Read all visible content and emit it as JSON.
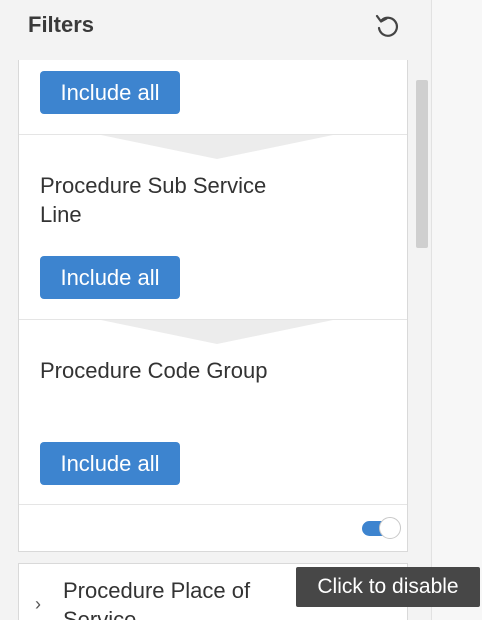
{
  "header": {
    "title": "Filters",
    "reset_icon": "reset-icon"
  },
  "filters": [
    {
      "title": "",
      "button_label": "Include all"
    },
    {
      "title": "Procedure Sub Service Line",
      "button_label": "Include all"
    },
    {
      "title": "Procedure Code Group",
      "button_label": "Include all"
    }
  ],
  "toggle": {
    "state": "on",
    "color": "#3d84cf"
  },
  "collapsed_filter": {
    "chevron_icon": "chevron-right-icon",
    "title": "Procedure Place of Service"
  },
  "tooltip": {
    "text": "Click to disable"
  }
}
